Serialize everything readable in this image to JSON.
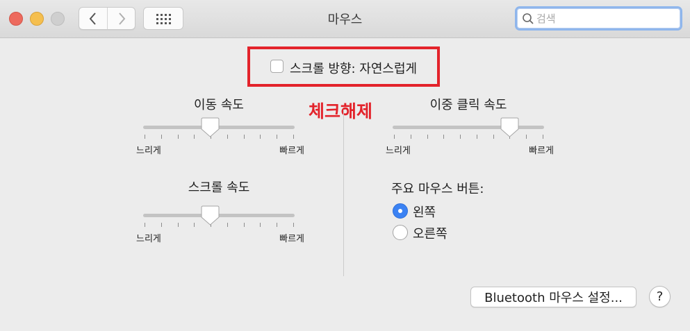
{
  "window": {
    "title": "마우스",
    "traffic_lights": [
      "close",
      "minimize",
      "zoom"
    ],
    "nav": {
      "back_icon": "chevron-left-icon",
      "forward_icon": "chevron-right-icon",
      "grid_icon": "grid-icon"
    },
    "search": {
      "placeholder": "검색",
      "value": "",
      "icon": "search-icon"
    }
  },
  "natural_scroll": {
    "label": "스크롤 방향: 자연스럽게",
    "checked": false,
    "highlight_color": "#e3232b"
  },
  "annotation": {
    "text": "체크해제",
    "color": "#e3232b"
  },
  "tracking_speed": {
    "title": "이동 속도",
    "min_label": "느리게",
    "max_label": "빠르게",
    "value": 0.44
  },
  "double_click_speed": {
    "title": "이중 클릭 속도",
    "min_label": "느리게",
    "max_label": "빠르게",
    "value": 0.78
  },
  "scroll_speed": {
    "title": "스크롤 속도",
    "min_label": "느리게",
    "max_label": "빠르게",
    "value": 0.44
  },
  "primary_button": {
    "label": "주요 마우스 버튼:",
    "options": [
      {
        "label": "왼쪽",
        "selected": true
      },
      {
        "label": "오른쪽",
        "selected": false
      }
    ],
    "accent_color": "#3b82f3"
  },
  "bluetooth_button": {
    "label": "Bluetooth 마우스 설정..."
  },
  "help_button": {
    "label": "?"
  }
}
